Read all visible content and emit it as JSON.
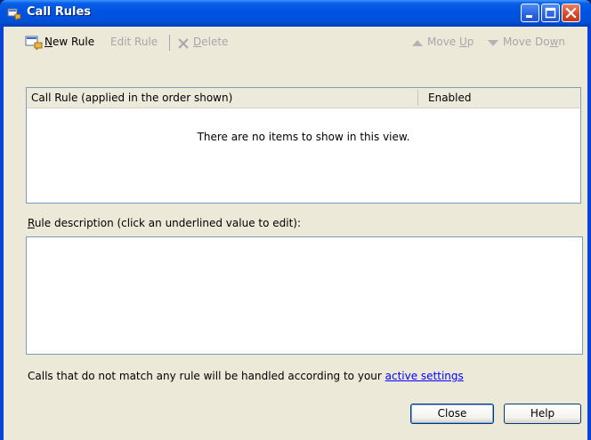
{
  "window": {
    "title": "Call Rules",
    "title_icon": "call-rules-icon",
    "controls": [
      "minimize-icon",
      "maximize-icon",
      "close-icon"
    ]
  },
  "toolbar": {
    "new_rule_mnemonic": "N",
    "new_rule_rest": "ew Rule",
    "edit_rule": "Edit Rule",
    "delete_mnemonic": "D",
    "delete_rest": "elete",
    "move_up_prefix": "Move ",
    "move_up_mnemonic": "U",
    "move_up_suffix": "p",
    "move_down_prefix": "Move Do",
    "move_down_mnemonic": "w",
    "move_down_suffix": "n"
  },
  "list": {
    "columns": [
      "Call Rule (applied in the order shown)",
      "Enabled"
    ],
    "empty_text": "There are no items to show in this view."
  },
  "description": {
    "label_mnemonic": "R",
    "label_rest": "ule description (click an underlined value to edit):"
  },
  "footer": {
    "text": "Calls that do not match any rule will be handled according to your ",
    "link": "active settings"
  },
  "buttons": {
    "close": "Close",
    "help": "Help"
  },
  "colors": {
    "titlebar": "#0054e3",
    "dialog_bg": "#ece9d8",
    "disabled_text": "#a7a6aa",
    "link": "#0000ff"
  }
}
